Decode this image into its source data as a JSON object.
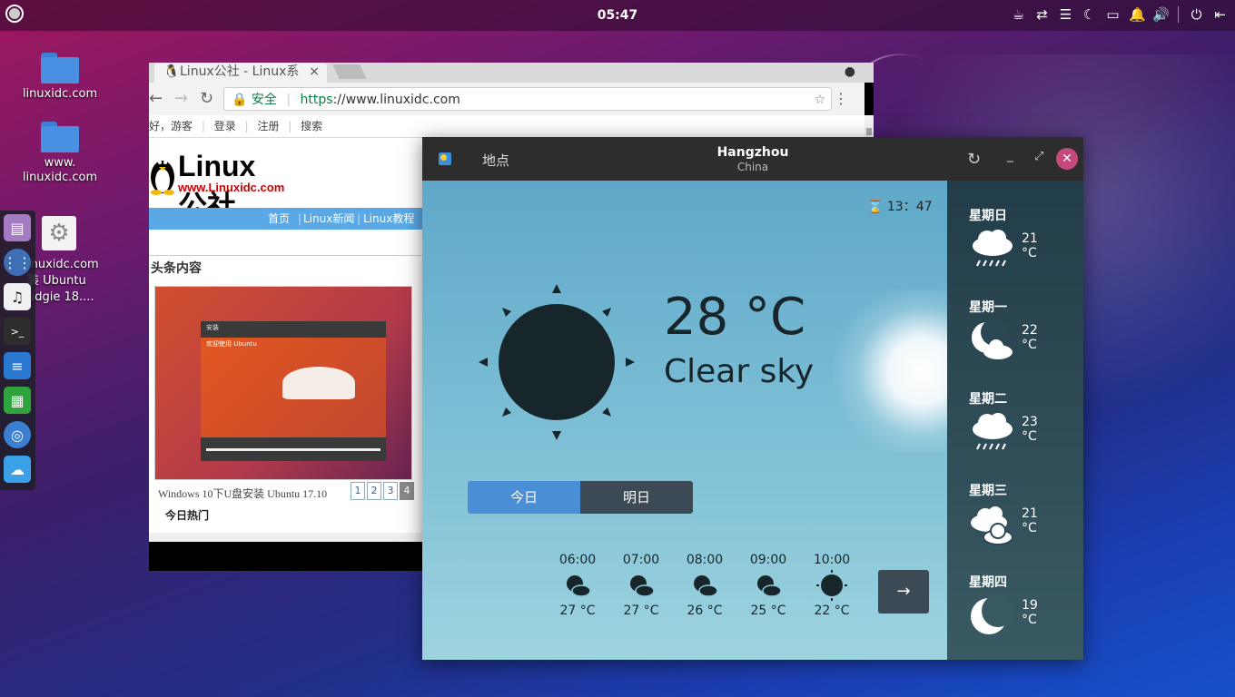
{
  "top_panel": {
    "clock": "05:47",
    "tray_icons": [
      "coffee-icon",
      "network-icon",
      "list-icon",
      "moon-icon",
      "folder-icon",
      "bell-icon",
      "volume-icon",
      "power-icon",
      "logout-icon"
    ]
  },
  "desktop": {
    "icons": [
      {
        "label": "linuxidc.com"
      },
      {
        "label_line1": "www.",
        "label_line2": "linuxidc.com"
      }
    ],
    "gear_label_line1": "inuxidc.com",
    "gear_label_line2": "装 Ubuntu",
    "gear_label_line3": "udgie 18...."
  },
  "browser": {
    "tab_title": "Linux公社 - Linux系",
    "tab_close": "×",
    "secure_label": "安全",
    "url_scheme": "https",
    "url_rest": "://www.linuxidc.com",
    "site": {
      "topbar": [
        "好，游客",
        "登录",
        "注册",
        "搜索"
      ],
      "logo_text": "Linux公社",
      "logo_url": "www.Linuxidc.com",
      "nav": [
        "首页",
        "Linux新闻",
        "Linux教程"
      ],
      "headline": "头条内容",
      "thumb_title": "安装",
      "thumb_welcome": "欢迎使用 Ubuntu",
      "caption": "Windows 10下U盘安装 Ubuntu 17.10",
      "pages": [
        "1",
        "2",
        "3",
        "4"
      ],
      "more": "今日热门"
    }
  },
  "weather": {
    "places_label": "地点",
    "city": "Hangzhou",
    "country": "China",
    "time": "13：47",
    "temperature": "28 °C",
    "condition": "Clear sky",
    "toggle_today": "今日",
    "toggle_tomorrow": "明日",
    "hourly": [
      {
        "time": "06:00",
        "temp": "27 °C",
        "icon": "night-cloud-icon"
      },
      {
        "time": "07:00",
        "temp": "27 °C",
        "icon": "night-cloud-icon"
      },
      {
        "time": "08:00",
        "temp": "26 °C",
        "icon": "night-cloud-icon"
      },
      {
        "time": "09:00",
        "temp": "25 °C",
        "icon": "night-cloud-icon"
      },
      {
        "time": "10:00",
        "temp": "22 °C",
        "icon": "sun-icon"
      }
    ],
    "forecast": [
      {
        "day": "星期日",
        "temp": "21 °C",
        "icon": "rain-icon"
      },
      {
        "day": "星期一",
        "temp": "22 °C",
        "icon": "moon-cloud-icon"
      },
      {
        "day": "星期二",
        "temp": "23 °C",
        "icon": "rain-icon"
      },
      {
        "day": "星期三",
        "temp": "21 °C",
        "icon": "cloudy-icon"
      },
      {
        "day": "星期四",
        "temp": "19 °C",
        "icon": "moon-icon"
      }
    ],
    "accent_colors": {
      "today": "#4a8fd6",
      "close": "#c7487a"
    }
  }
}
